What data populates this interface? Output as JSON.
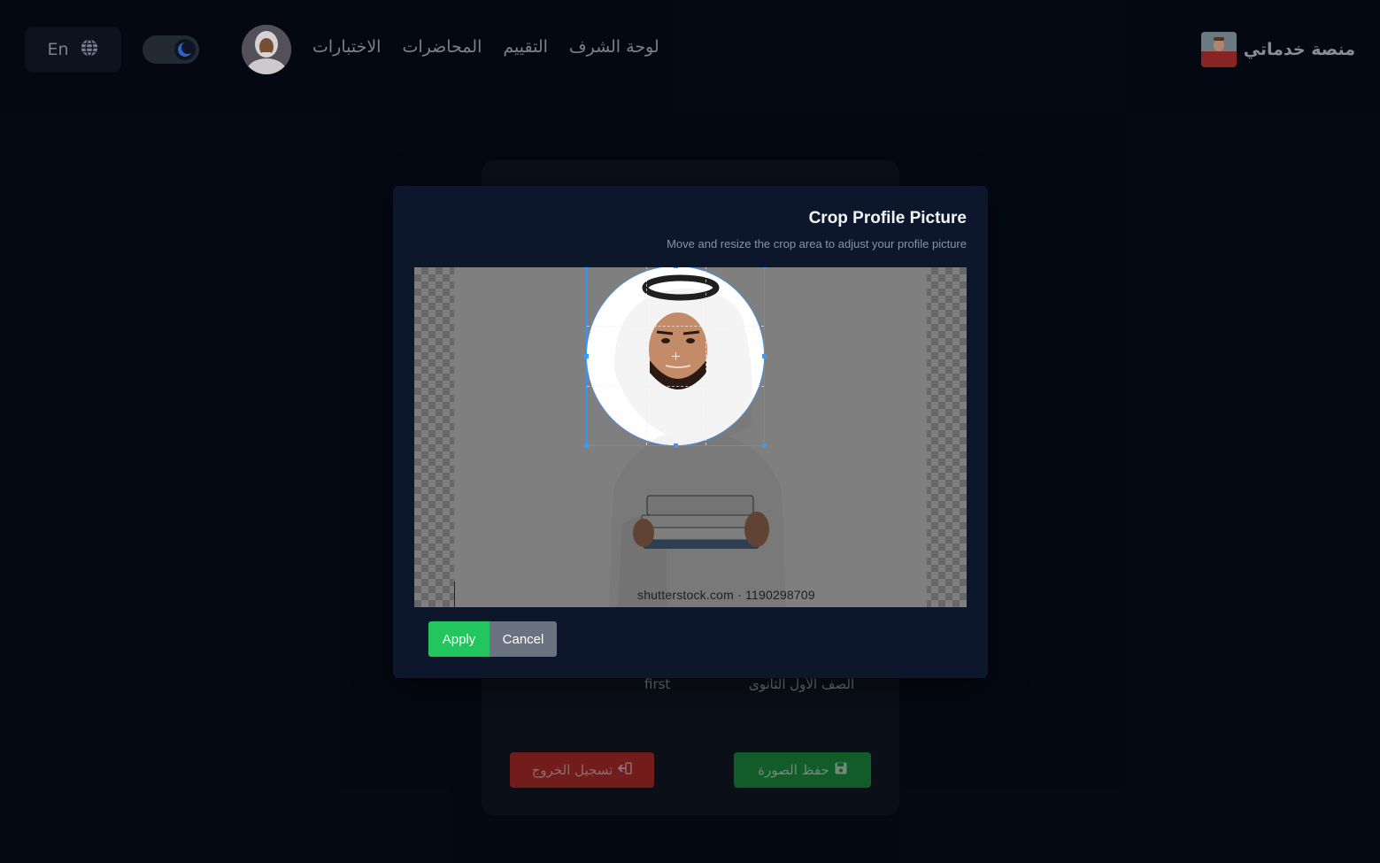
{
  "navbar": {
    "language_label": "En",
    "links": [
      "الاختبارات",
      "المحاضرات",
      "التقييم",
      "لوحة الشرف"
    ],
    "brand_title": "منصة خدماتي"
  },
  "profile_card": {
    "grade_label": "الصف الأول الثانوى",
    "grade_value": "first",
    "logout_label": "تسجيل الخروج",
    "save_photo_label": "حفظ الصورة"
  },
  "crop_modal": {
    "title": "Crop Profile Picture",
    "subtitle": "Move and resize the crop area to adjust your profile picture",
    "watermark": "shutterstock.com · 1190298709",
    "apply_label": "Apply",
    "cancel_label": "Cancel"
  },
  "colors": {
    "page_background": "#050a15",
    "modal_background": "#0d172c",
    "apply": "#22c55e",
    "cancel": "#6b7280",
    "crop_accent": "#3b99fc",
    "logout": "#822020",
    "save_photo": "#14692f"
  },
  "icons": {
    "language": "globe-icon",
    "theme": "moon-icon",
    "logout": "sign-out-icon",
    "save": "floppy-disk-icon"
  }
}
